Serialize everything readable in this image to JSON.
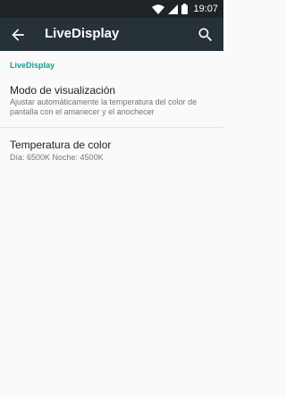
{
  "statusbar": {
    "time": "19:07",
    "icons": [
      "wifi-icon",
      "signal-icon",
      "battery-icon"
    ]
  },
  "toolbar": {
    "title": "LiveDisplay",
    "back_icon": "arrow-back-icon",
    "search_icon": "search-icon"
  },
  "category": {
    "label": "LiveDisplay",
    "color": "#1a9a8c"
  },
  "preferences": [
    {
      "title": "Modo de visualización",
      "summary": "Ajustar automáticamente la temperatura del color de pantalla con el amanecer y el anochecer"
    },
    {
      "title": "Temperatura de color",
      "summary": "Día: 6500K Noche: 4500K"
    }
  ],
  "colors": {
    "toolbar": "#263238",
    "statusbar": "#1e2326",
    "background": "#fafafa"
  }
}
